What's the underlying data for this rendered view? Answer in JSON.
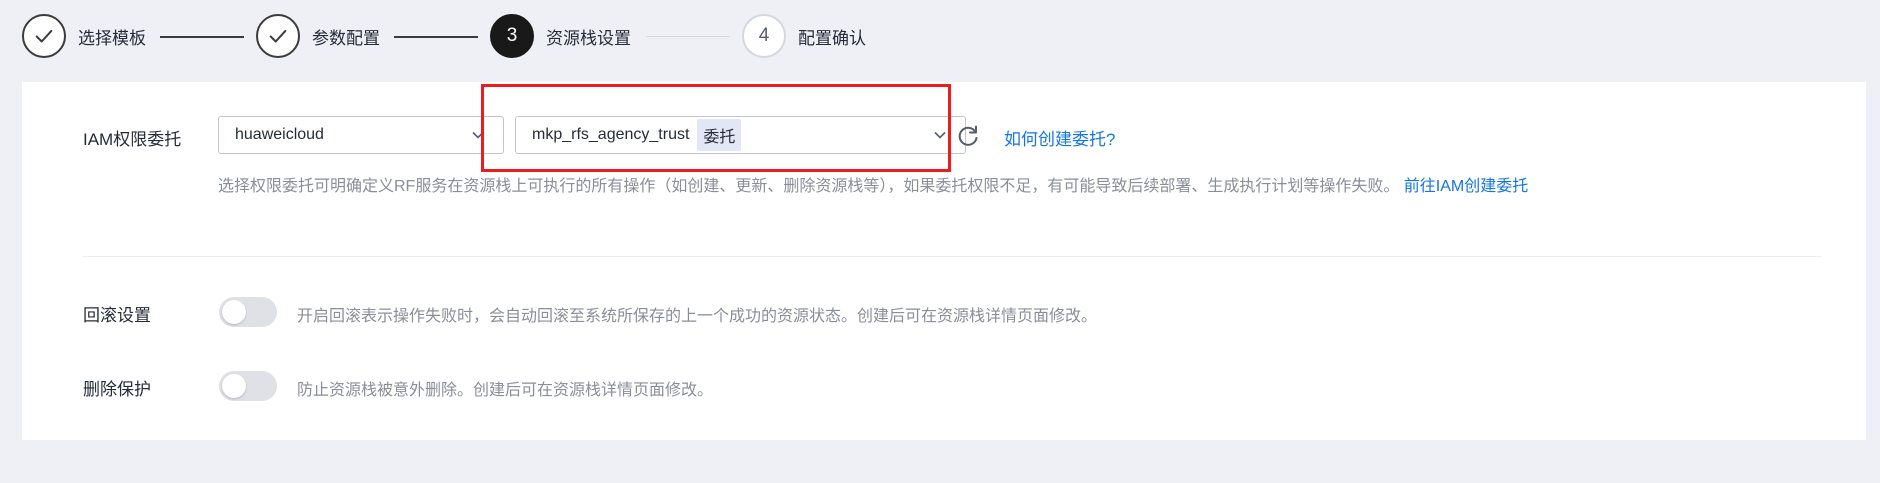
{
  "stepper": {
    "steps": [
      {
        "number": "",
        "label": "选择模板",
        "state": "done"
      },
      {
        "number": "",
        "label": "参数配置",
        "state": "done"
      },
      {
        "number": "3",
        "label": "资源栈设置",
        "state": "active"
      },
      {
        "number": "4",
        "label": "配置确认",
        "state": "pending"
      }
    ]
  },
  "iam": {
    "label": "IAM权限委托",
    "provider_select": "huaweicloud",
    "agency_select": "mkp_rfs_agency_trust",
    "agency_tag": "委托",
    "help_link": "如何创建委托?",
    "description": "选择权限委托可明确定义RF服务在资源栈上可执行的所有操作（如创建、更新、删除资源栈等），如果委托权限不足，有可能导致后续部署、生成执行计划等操作失败。",
    "description_link": "前往IAM创建委托"
  },
  "rollback": {
    "label": "回滚设置",
    "enabled": false,
    "description": "开启回滚表示操作失败时，会自动回滚至系统所保存的上一个成功的资源状态。创建后可在资源栈详情页面修改。"
  },
  "delete_protection": {
    "label": "删除保护",
    "enabled": false,
    "description": "防止资源栈被意外删除。创建后可在资源栈详情页面修改。"
  },
  "colors": {
    "accent_link": "#1476e6",
    "highlight": "#ee1c1c",
    "active_step": "#191919"
  }
}
